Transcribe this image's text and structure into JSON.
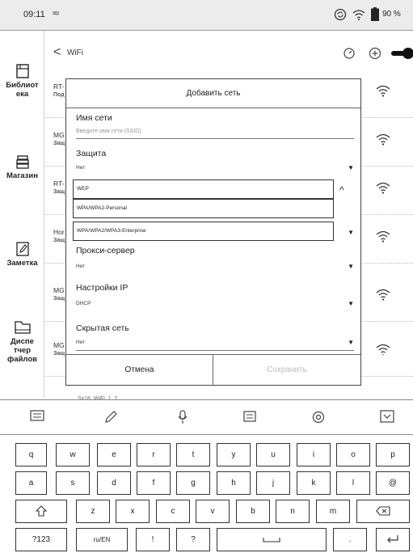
{
  "status": {
    "time": "09:11",
    "clip_glyph": "≂",
    "battery": "90 %"
  },
  "sidebar": {
    "items": [
      {
        "label": "Библиот\nека",
        "icon": "library-icon"
      },
      {
        "label": "Магазин",
        "icon": "shop-icon"
      },
      {
        "label": "Заметка",
        "icon": "note-icon"
      },
      {
        "label": "Диспе\nтчер\nфайлов",
        "icon": "file-manager-icon"
      }
    ]
  },
  "header": {
    "back": "<",
    "title": "WiFi"
  },
  "networks": [
    {
      "ssid": "RT-",
      "state": "Под"
    },
    {
      "ssid": "MG",
      "state": "Защ"
    },
    {
      "ssid": "RT-",
      "state": "Защ"
    },
    {
      "ssid": "Hor",
      "state": "Защ"
    },
    {
      "ssid": "MG",
      "state": "Защ"
    },
    {
      "ssid": "MG",
      "state": "Защ"
    }
  ],
  "partial_row": "Sx18_WiFi_1_7",
  "dialog": {
    "title": "Добавить сеть",
    "ssid_label": "Имя сети",
    "ssid_placeholder": "Введите имя сети (SSID)",
    "security_label": "Защита",
    "security_value": "Нет",
    "security_options": [
      "WEP",
      "WPA/WPA2-Personal",
      "WPA/WPA2/WPA3-Enterprise"
    ],
    "proxy_label": "Прокси-сервер",
    "proxy_value": "Нет",
    "ip_label": "Настройки IP",
    "ip_value": "DHCP",
    "hidden_label": "Скрытая сеть",
    "hidden_value": "Нет",
    "cancel": "Отмена",
    "save": "Сохранить"
  },
  "keyboard": {
    "row1": [
      "q",
      "w",
      "e",
      "r",
      "t",
      "y",
      "u",
      "i",
      "o",
      "p"
    ],
    "row2": [
      "a",
      "s",
      "d",
      "f",
      "g",
      "h",
      "j",
      "k",
      "l",
      "@"
    ],
    "row3": [
      "z",
      "x",
      "c",
      "v",
      "b",
      "n",
      "m"
    ],
    "row4": {
      "num": "?123",
      "lang": "ru/EN",
      "excl": "!",
      "quest": "?",
      "dot": "."
    }
  }
}
